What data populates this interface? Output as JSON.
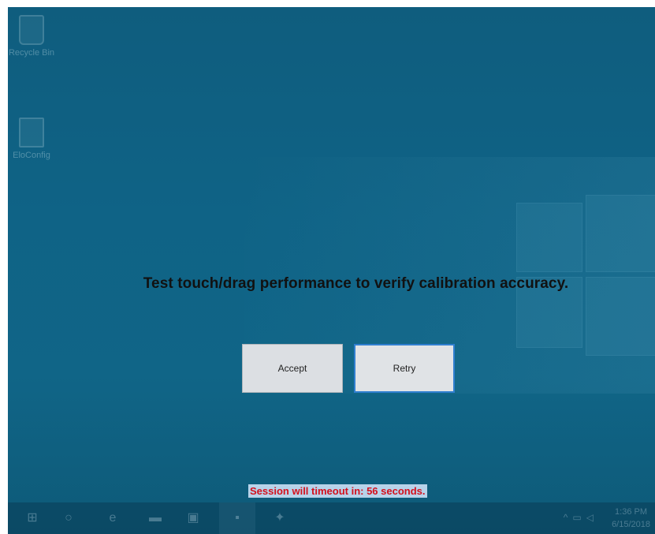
{
  "desktop": {
    "icons": [
      {
        "label": "Recycle Bin",
        "icon": "recycle-bin-icon"
      },
      {
        "label": "EloConfig",
        "icon": "app-icon"
      }
    ]
  },
  "dialog": {
    "message": "Test touch/drag performance to verify calibration accuracy.",
    "accept_label": "Accept",
    "retry_label": "Retry",
    "timeout_text": "Session will timeout in: 56 seconds."
  },
  "taskbar": {
    "icons": [
      "start-icon",
      "cortana-icon",
      "edge-icon",
      "file-explorer-icon",
      "store-icon",
      "app-icon",
      "settings-icon"
    ],
    "tray_icons": [
      "chevron-up-icon",
      "network-icon",
      "volume-icon"
    ],
    "time": "1:36 PM",
    "date": "6/15/2018"
  },
  "colors": {
    "timeout_text": "#d4101c",
    "timeout_highlight": "#b7d3ea",
    "retry_focus_border": "#2f7fd0",
    "desktop_background": "#0f6386"
  }
}
